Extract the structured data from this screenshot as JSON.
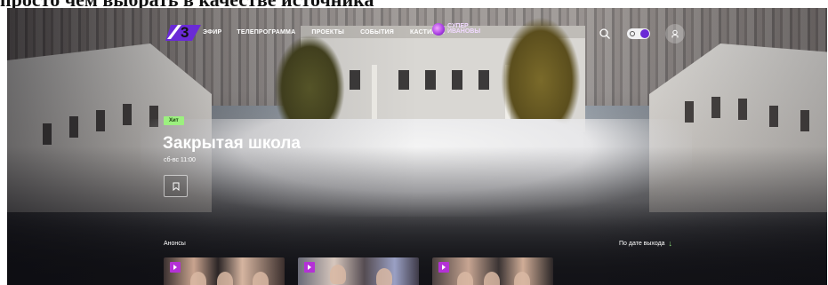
{
  "caption": {
    "text": "просто чем выбрать в качестве источника"
  },
  "header": {
    "logo_text": "3",
    "nav": [
      {
        "label": "Эфир"
      },
      {
        "label": "Телепрограмма"
      },
      {
        "label": "Проекты"
      },
      {
        "label": "События"
      },
      {
        "label": "Кастинги"
      }
    ],
    "promo": {
      "line1": "СУПЕР",
      "line2": "ИВАНОВЫ"
    },
    "icons": {
      "search": "search-icon",
      "theme": "theme-toggle-icon",
      "profile": "profile-icon"
    },
    "accent": "#7b3fe4"
  },
  "hero": {
    "badge": "Хит",
    "title": "Закрытая школа",
    "schedule": "сб-вс 11:00",
    "bookmark_icon": "bookmark-icon",
    "badge_color": "#9cf07f"
  },
  "announcements": {
    "title": "Анонсы",
    "sort_label": "По дате выхода",
    "sort_icon": "arrow-down-icon",
    "cards": [
      {
        "label": "video-1"
      },
      {
        "label": "video-2"
      },
      {
        "label": "video-3"
      }
    ],
    "play_color": "#b431d6"
  }
}
